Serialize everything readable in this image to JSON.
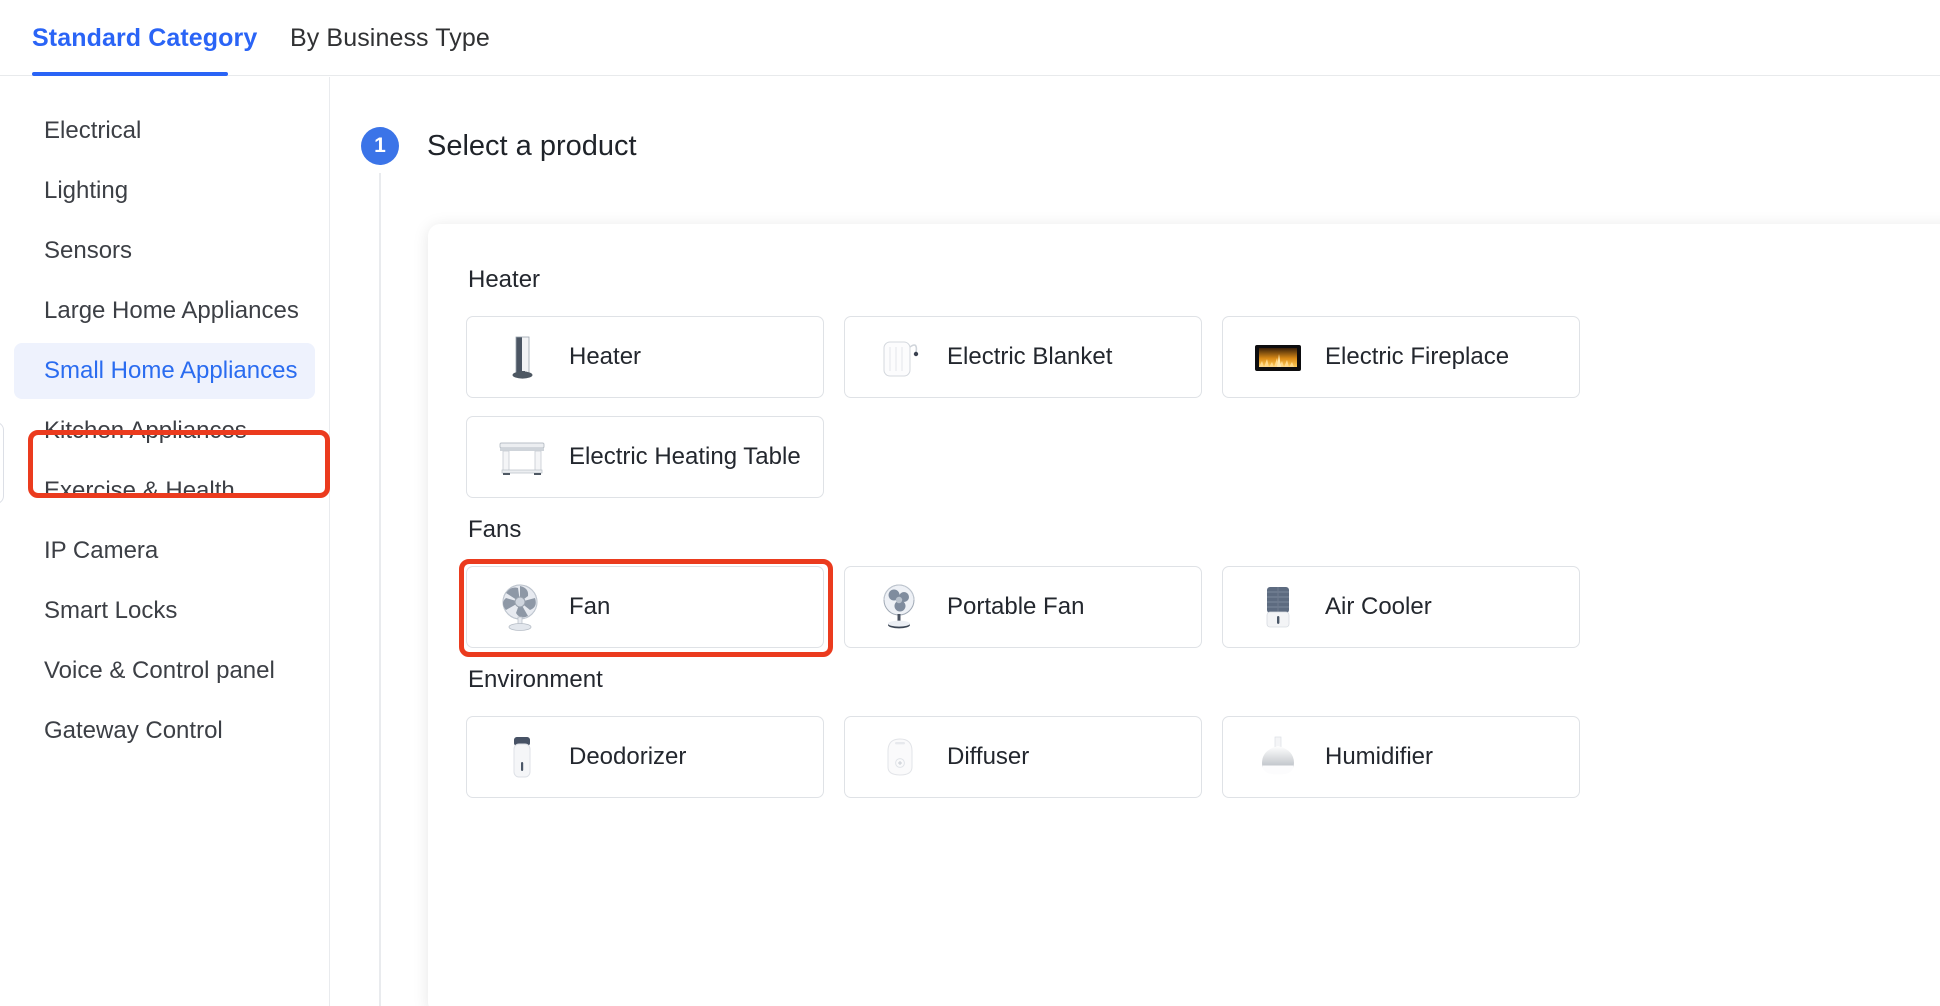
{
  "tabs": [
    {
      "label": "Standard Category",
      "active": true
    },
    {
      "label": "By Business Type",
      "active": false
    }
  ],
  "sidebar": {
    "items": [
      {
        "label": "Electrical"
      },
      {
        "label": "Lighting"
      },
      {
        "label": "Sensors"
      },
      {
        "label": "Large Home Appliances"
      },
      {
        "label": "Small Home Appliances"
      },
      {
        "label": "Kitchen Appliances"
      },
      {
        "label": "Exercise & Health"
      },
      {
        "label": "IP Camera"
      },
      {
        "label": "Smart Locks"
      },
      {
        "label": "Voice & Control panel"
      },
      {
        "label": "Gateway Control"
      }
    ],
    "active_index": 4
  },
  "step": {
    "number": "1",
    "title": "Select a product"
  },
  "groups": [
    {
      "title": "Heater",
      "rows": [
        [
          {
            "label": "Heater",
            "icon": "tower-heater-icon",
            "selected": false
          },
          {
            "label": "Electric Blanket",
            "icon": "electric-blanket-icon",
            "selected": false
          },
          {
            "label": "Electric Fireplace",
            "icon": "electric-fireplace-icon",
            "selected": false
          }
        ],
        [
          {
            "label": "Electric Heating Table",
            "icon": "electric-heating-table-icon",
            "selected": false
          }
        ]
      ]
    },
    {
      "title": "Fans",
      "rows": [
        [
          {
            "label": "Fan",
            "icon": "desk-fan-icon",
            "selected": true
          },
          {
            "label": "Portable Fan",
            "icon": "portable-fan-icon",
            "selected": false
          },
          {
            "label": "Air Cooler",
            "icon": "air-cooler-icon",
            "selected": false
          }
        ]
      ]
    },
    {
      "title": "Environment",
      "rows": [
        [
          {
            "label": "Deodorizer",
            "icon": "deodorizer-icon",
            "selected": false
          },
          {
            "label": "Diffuser",
            "icon": "diffuser-icon",
            "selected": false
          },
          {
            "label": "Humidifier",
            "icon": "humidifier-icon",
            "selected": false
          }
        ]
      ]
    }
  ],
  "colors": {
    "accent_blue": "#2a64f6",
    "annotation_red": "#eb3b1e",
    "active_bg": "#eef2fd",
    "text_primary": "#23272e",
    "border": "#dfe2e6"
  }
}
